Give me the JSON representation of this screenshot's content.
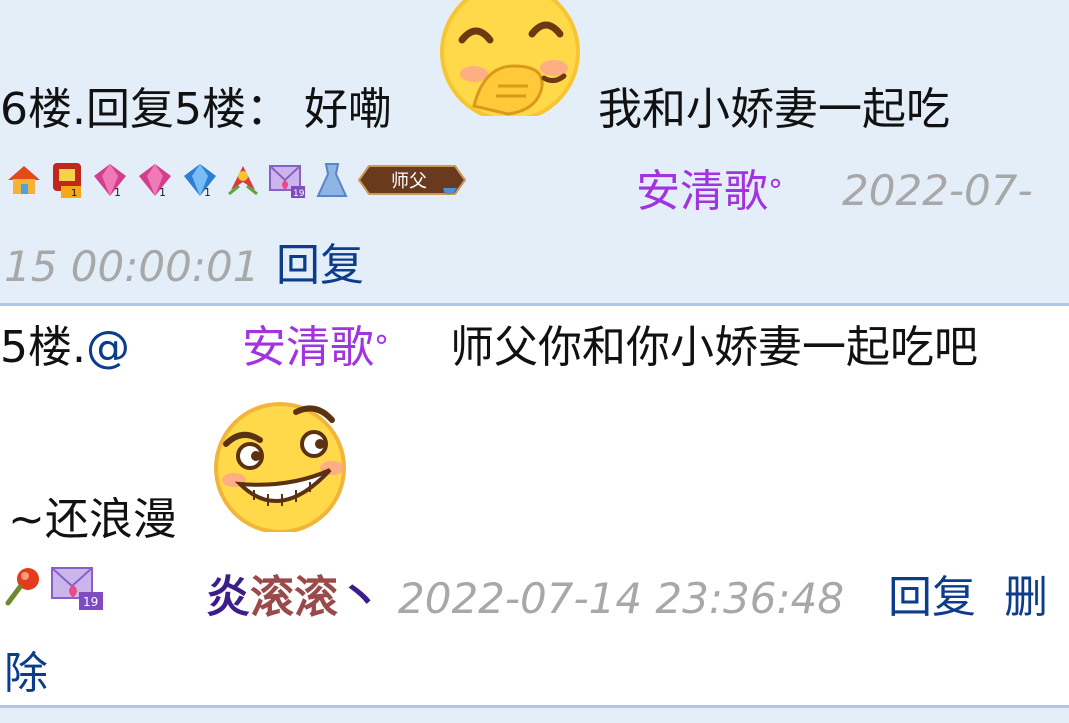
{
  "posts": [
    {
      "floor_label": "6楼.",
      "reply_prefix": "回复5楼：",
      "text_before": "好嘞",
      "text_after": "我和小娇妻一起吃",
      "emoji": "cover-mouth-smile-emoji",
      "username": "安清歌",
      "username_suffix": "°",
      "timestamp_part1": "2022-07-",
      "timestamp_part2": "15 00:00:01",
      "reply_link": "回复",
      "badge_text": "师父"
    },
    {
      "floor_label": "5楼.",
      "mention_at": "@",
      "mention_user": "安清歌",
      "mention_suffix": "°",
      "text_line1": "师父你和你小娇妻一起吃吧",
      "text_line2": "~还浪漫",
      "emoji": "smug-grin-emoji",
      "username_part1": "炎",
      "username_part2": "滚滚",
      "username_part3": "丶",
      "timestamp": "2022-07-14 23:36:48",
      "reply_link": "回复",
      "delete_link_part1": "删",
      "delete_link_part2": "除"
    }
  ],
  "colors": {
    "post_bg_alt": "#e3eef8",
    "divider": "#a9c9ea",
    "link": "#0c3c8c",
    "timestamp": "#a8a8a8",
    "username_purple": "#a233e0",
    "username_dark": "#3b1e8a"
  },
  "icons": [
    "home-icon",
    "medal-icon",
    "gem-level-icon",
    "ribbon-icon",
    "heart-envelope-icon",
    "dress-icon",
    "master-badge-icon",
    "pin-icon"
  ]
}
